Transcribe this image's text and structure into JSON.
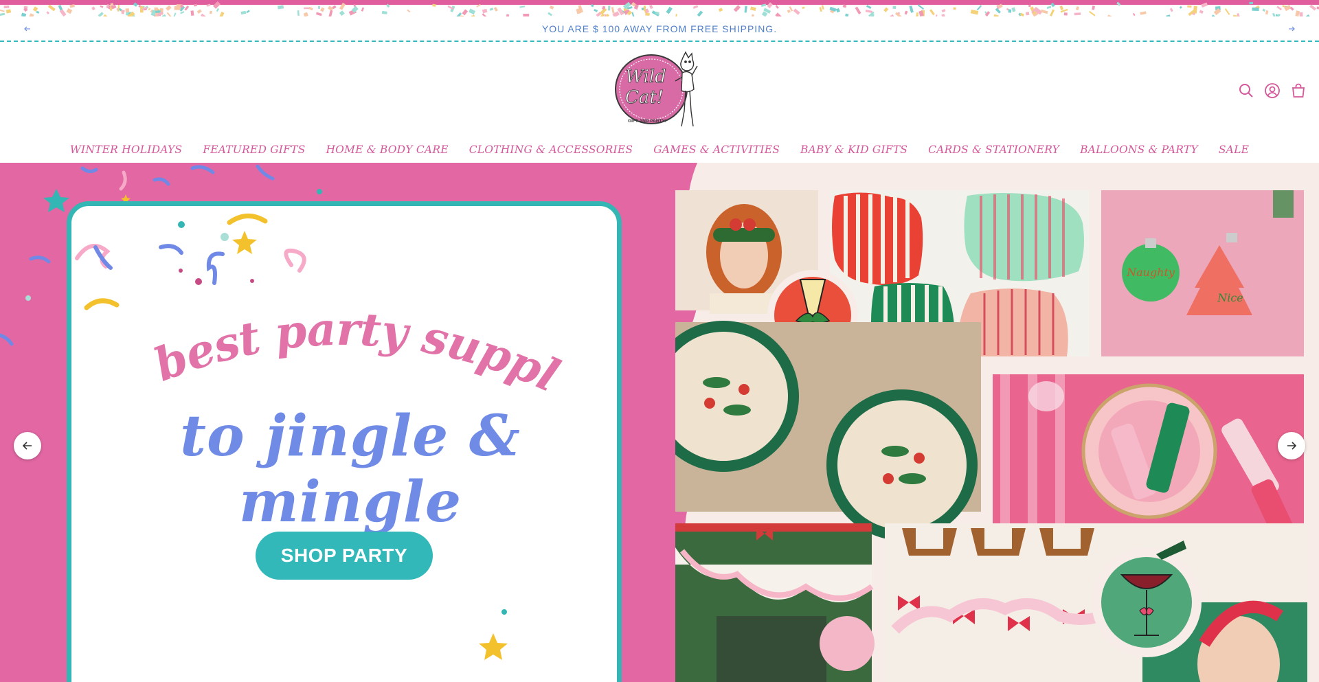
{
  "announcement": {
    "text": "YOU ARE $ 100 AWAY FROM FREE SHIPPING.",
    "prev_icon": "arrow-left-icon",
    "next_icon": "arrow-right-icon"
  },
  "logo": {
    "line1": "Wild",
    "line2": "Cat!",
    "tagline": "GIFT AND PARTY!"
  },
  "header_icons": [
    "search-icon",
    "account-icon",
    "cart-icon"
  ],
  "nav": {
    "items": [
      "WINTER HOLIDAYS",
      "FEATURED GIFTS",
      "HOME & BODY CARE",
      "CLOTHING & ACCESSORIES",
      "GAMES & ACTIVITIES",
      "BABY & KID GIFTS",
      "CARDS & STATIONERY",
      "BALLOONS & PARTY",
      "SALE"
    ]
  },
  "hero": {
    "headline_1": "the best party supplies",
    "headline_2": "to jingle & mingle",
    "button_label": "SHOP PARTY",
    "prev_label": "←",
    "next_label": "→",
    "ornament_1": "Naughty",
    "ornament_2": "Nice"
  },
  "colors": {
    "brand_pink": "#e267a3",
    "teal": "#33b6b4",
    "periwinkle": "#6f8be6",
    "nav_pink": "#d4589a"
  }
}
